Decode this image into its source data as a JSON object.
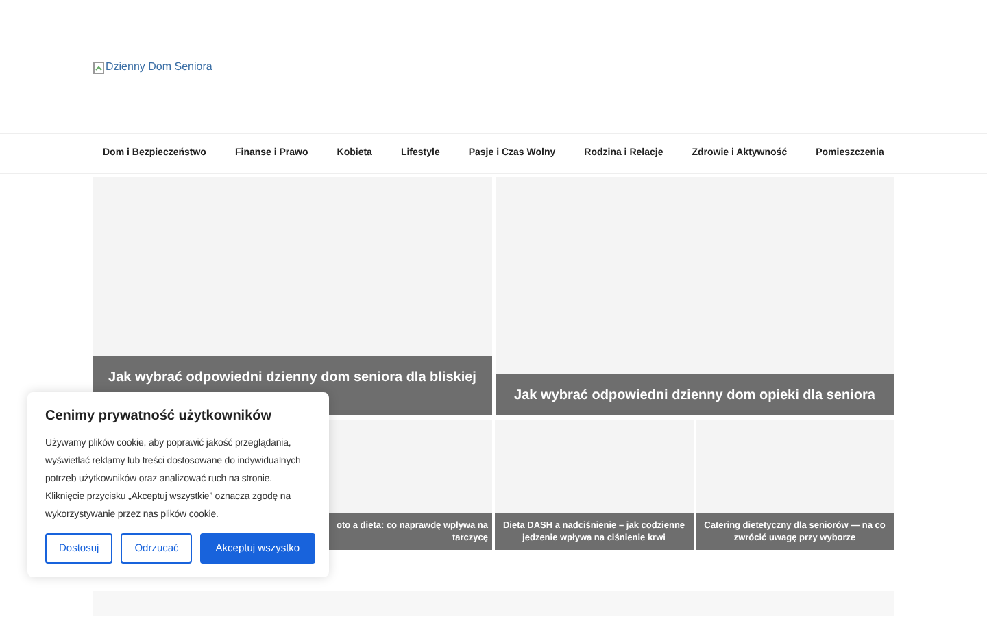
{
  "logo": {
    "alt": "Dzienny Dom Seniora"
  },
  "nav": {
    "items": [
      "Dom i Bezpieczeństwo",
      "Finanse i Prawo",
      "Kobieta",
      "Lifestyle",
      "Pasje i Czas Wolny",
      "Rodzina i Relacje",
      "Zdrowie i Aktywność",
      "Pomieszczenia"
    ]
  },
  "featured": [
    {
      "title": "Jak wybrać odpowiedni dzienny dom seniora dla bliskiej"
    },
    {
      "title": "Jak wybrać odpowiedni dzienny dom opieki dla seniora"
    }
  ],
  "articles": [
    {
      "title": "oto a dieta: co naprawdę wpływa na tarczycę"
    },
    {
      "title": "Dieta DASH a nadciśnienie – jak codzienne jedzenie wpływa na ciśnienie krwi"
    },
    {
      "title": "Catering dietetyczny dla seniorów — na co zwrócić uwagę przy wyborze"
    }
  ],
  "cookie_banner": {
    "title": "Cenimy prywatność użytkowników",
    "text": "Używamy plików cookie, aby poprawić jakość przeglądania, wyświetlać reklamy lub treści dostosowane do indywidualnych potrzeb użytkowników oraz analizować ruch na stronie. Kliknięcie przycisku „Akceptuj wszystkie” oznacza zgodę na wykorzystywanie przez nas plików cookie.",
    "buttons": [
      {
        "label": "Dostosuj",
        "kind": "outline"
      },
      {
        "label": "Odrzucać",
        "kind": "outline"
      },
      {
        "label": "Akceptuj wszystko",
        "kind": "primary"
      }
    ]
  }
}
